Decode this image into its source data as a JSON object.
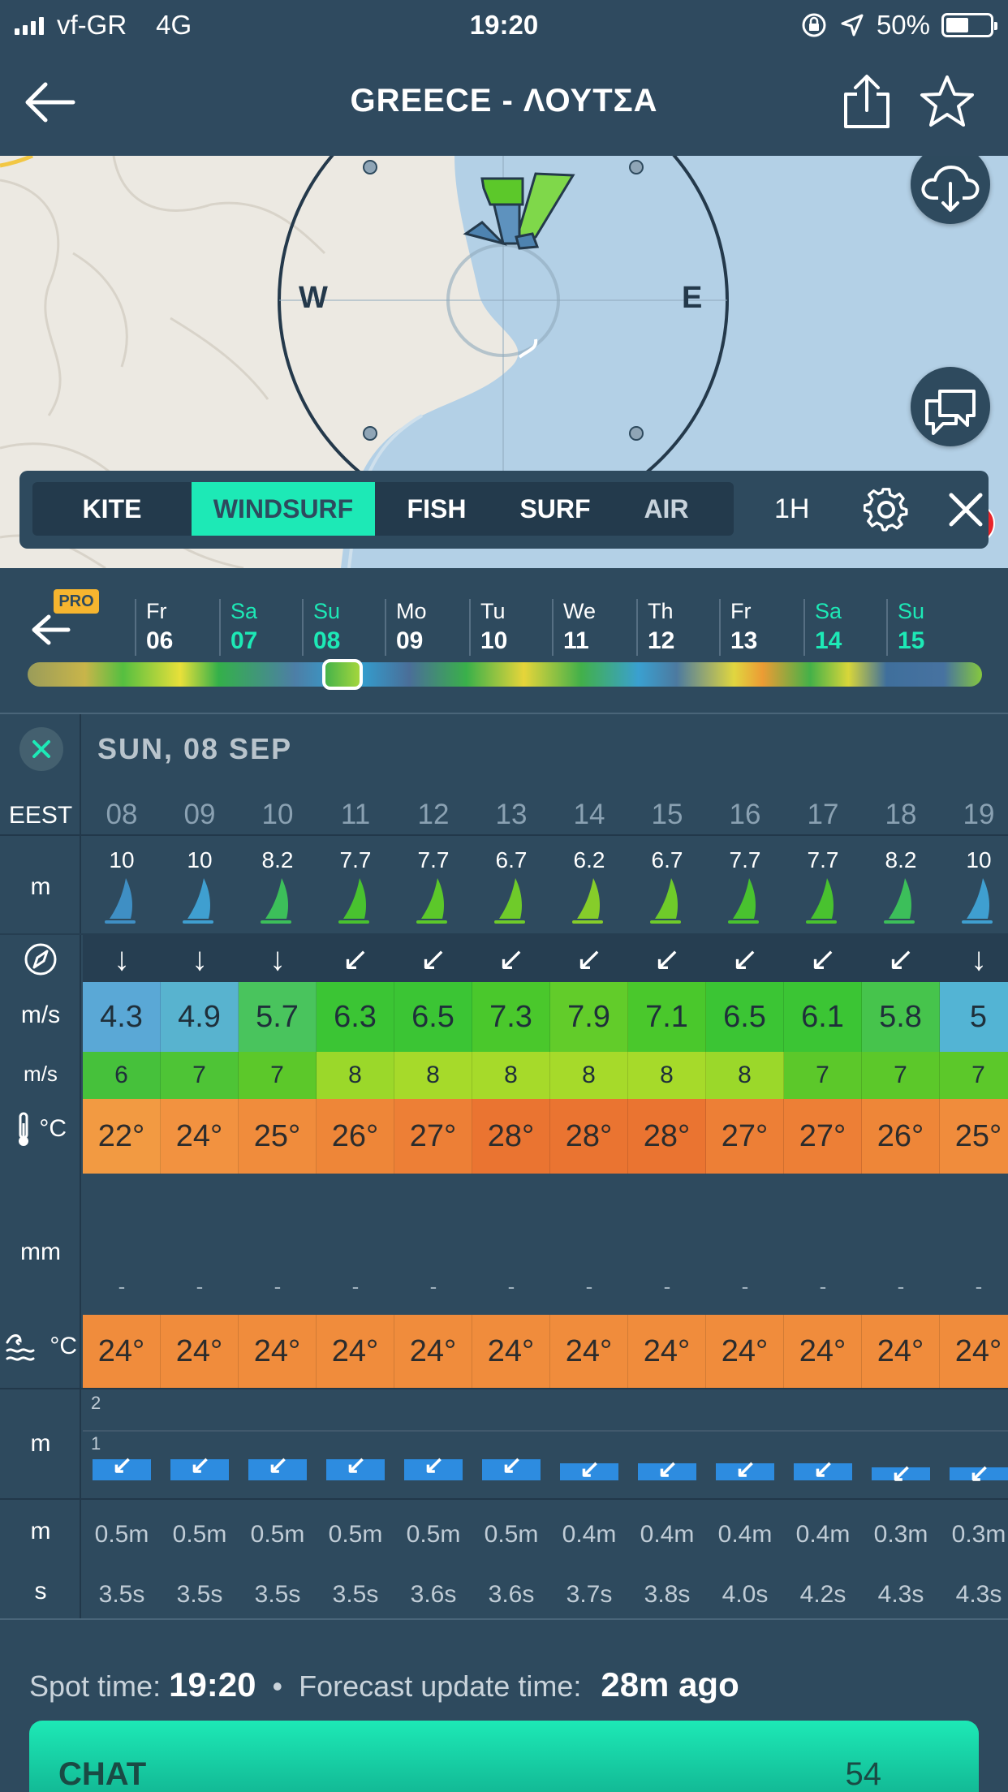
{
  "status_bar": {
    "carrier": "vf-GR",
    "network": "4G",
    "time": "19:20",
    "battery": "50%"
  },
  "header": {
    "title": "GREECE - ΛΟΥΤΣΑ"
  },
  "map": {
    "compass_west": "W",
    "compass_east": "E",
    "chat_badge": "54"
  },
  "sports": {
    "tabs": [
      {
        "label": "KITE",
        "active": false
      },
      {
        "label": "WINDSURF",
        "active": true
      },
      {
        "label": "FISH",
        "active": false
      },
      {
        "label": "SURF",
        "active": false
      },
      {
        "label": "AIR",
        "active": false
      }
    ],
    "interval": "1H"
  },
  "days": {
    "pro_label": "PRO",
    "items": [
      {
        "name": "Fr",
        "num": "06",
        "weekend": false
      },
      {
        "name": "Sa",
        "num": "07",
        "weekend": true
      },
      {
        "name": "Su",
        "num": "08",
        "weekend": true
      },
      {
        "name": "Mo",
        "num": "09",
        "weekend": false
      },
      {
        "name": "Tu",
        "num": "10",
        "weekend": false
      },
      {
        "name": "We",
        "num": "11",
        "weekend": false
      },
      {
        "name": "Th",
        "num": "12",
        "weekend": false
      },
      {
        "name": "Fr",
        "num": "13",
        "weekend": false
      },
      {
        "name": "Sa",
        "num": "14",
        "weekend": true
      },
      {
        "name": "Su",
        "num": "15",
        "weekend": true
      }
    ]
  },
  "forecast": {
    "day_title": "SUN, 08 SEP",
    "labels": {
      "timezone": "EEST",
      "sail_unit": "m",
      "wind_unit": "m/s",
      "gust_unit": "m/s",
      "temp_unit": "°C",
      "rain_unit": "mm",
      "sea_temp_unit": "°C",
      "wave_unit": "m",
      "wave_height_unit": "m",
      "period_unit": "s"
    },
    "hours": [
      "08",
      "09",
      "10",
      "11",
      "12",
      "13",
      "14",
      "15",
      "16",
      "17",
      "18",
      "19"
    ],
    "sail_sizes": [
      "10",
      "10",
      "8.2",
      "7.7",
      "7.7",
      "6.7",
      "6.2",
      "6.7",
      "7.7",
      "7.7",
      "8.2",
      "10"
    ],
    "sail_colors": [
      "#3f8fc4",
      "#3f9fd0",
      "#3cbf5a",
      "#49c22f",
      "#5cc82a",
      "#6fcb2a",
      "#86cd2a",
      "#6fcb2a",
      "#49c22f",
      "#49c22f",
      "#3cbf5a",
      "#3f9fd0"
    ],
    "wind_dirs": [
      "↓",
      "↓",
      "↓",
      "↙",
      "↙",
      "↙",
      "↙",
      "↙",
      "↙",
      "↙",
      "↙",
      "↓"
    ],
    "wind_speed": [
      "4.3",
      "4.9",
      "5.7",
      "6.3",
      "6.5",
      "7.3",
      "7.9",
      "7.1",
      "6.5",
      "6.1",
      "5.8",
      "5"
    ],
    "wind_colors": [
      "#5aa8d6",
      "#58b3cf",
      "#49c45d",
      "#3bc534",
      "#3bc534",
      "#4ac82c",
      "#62cc2a",
      "#4ac82c",
      "#3bc534",
      "#3bc534",
      "#46c44c",
      "#53b4d4"
    ],
    "gusts": [
      "6",
      "7",
      "7",
      "8",
      "8",
      "8",
      "8",
      "8",
      "8",
      "7",
      "7",
      "7"
    ],
    "gust_colors": [
      "#46c13b",
      "#4ec436",
      "#5cc82a",
      "#9bd82a",
      "#a6da2a",
      "#a6da2a",
      "#a6da2a",
      "#a6da2a",
      "#9bd82a",
      "#5cc82a",
      "#5cc82a",
      "#5cc82a"
    ],
    "temps": [
      "22°",
      "24°",
      "25°",
      "26°",
      "27°",
      "28°",
      "28°",
      "28°",
      "27°",
      "27°",
      "26°",
      "25°"
    ],
    "temp_colors": [
      "#f29a42",
      "#f29240",
      "#f08c3c",
      "#ee8638",
      "#ed7f36",
      "#ea7431",
      "#ea7431",
      "#ea7431",
      "#ed7f36",
      "#ed7f36",
      "#ee8638",
      "#f08c3c"
    ],
    "rain": [
      "-",
      "-",
      "-",
      "-",
      "-",
      "-",
      "-",
      "-",
      "-",
      "-",
      "-",
      "-"
    ],
    "sea_temps": [
      "24°",
      "24°",
      "24°",
      "24°",
      "24°",
      "24°",
      "24°",
      "24°",
      "24°",
      "24°",
      "24°",
      "24°"
    ],
    "wave_axis": [
      "2",
      "1"
    ],
    "wave_heights_fraction": [
      0.5,
      0.5,
      0.5,
      0.5,
      0.5,
      0.5,
      0.4,
      0.4,
      0.4,
      0.4,
      0.3,
      0.3
    ],
    "wave_heights": [
      "0.5m",
      "0.5m",
      "0.5m",
      "0.5m",
      "0.5m",
      "0.5m",
      "0.4m",
      "0.4m",
      "0.4m",
      "0.4m",
      "0.3m",
      "0.3m"
    ],
    "wave_periods": [
      "3.5s",
      "3.5s",
      "3.5s",
      "3.5s",
      "3.6s",
      "3.6s",
      "3.7s",
      "3.8s",
      "4.0s",
      "4.2s",
      "4.3s",
      "4.3s"
    ]
  },
  "footer": {
    "spot_label": "Spot time:",
    "spot_time": "19:20",
    "update_label": "Forecast update time:",
    "update_value": "28m ago",
    "chat_label": "CHAT",
    "chat_count": "54"
  },
  "colors": {
    "accent": "#1de9b6",
    "background": "#2e4a5e",
    "badge": "#e8242a"
  }
}
